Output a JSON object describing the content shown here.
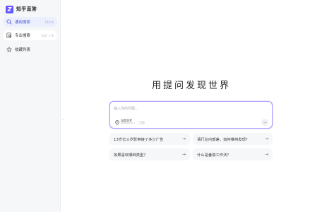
{
  "brand": {
    "name": "知乎直答",
    "logo_text": "Z"
  },
  "sidebar": {
    "items": [
      {
        "label": "通用搜索",
        "shortcut": "Ctrl  K",
        "icon": "search-icon"
      },
      {
        "label": "专业搜索",
        "shortcut": "Ctrl  ⇧  K",
        "icon": "pro-search-icon"
      },
      {
        "label": "收藏列表",
        "icon": "star-icon"
      }
    ]
  },
  "collapse_glyph": "‹",
  "main": {
    "title": "用提问发现世界",
    "search": {
      "placeholder": "输入你的问题...",
      "deep_label": "深度思考",
      "deep_sublabel": "DeepSeek-R1 ×",
      "send_glyph": "→"
    },
    "suggestions": [
      "13岁亿三岁影帝接了多少广告",
      "请行业内部差，如何维持发现？",
      "如果喜欢哪种类型？",
      "什么是番茄工作法？"
    ],
    "arrow_glyph": "→"
  },
  "colors": {
    "accent": "#4b5bd6",
    "search_border": "#a79bff",
    "sidebar_bg": "#f6f7f9"
  }
}
